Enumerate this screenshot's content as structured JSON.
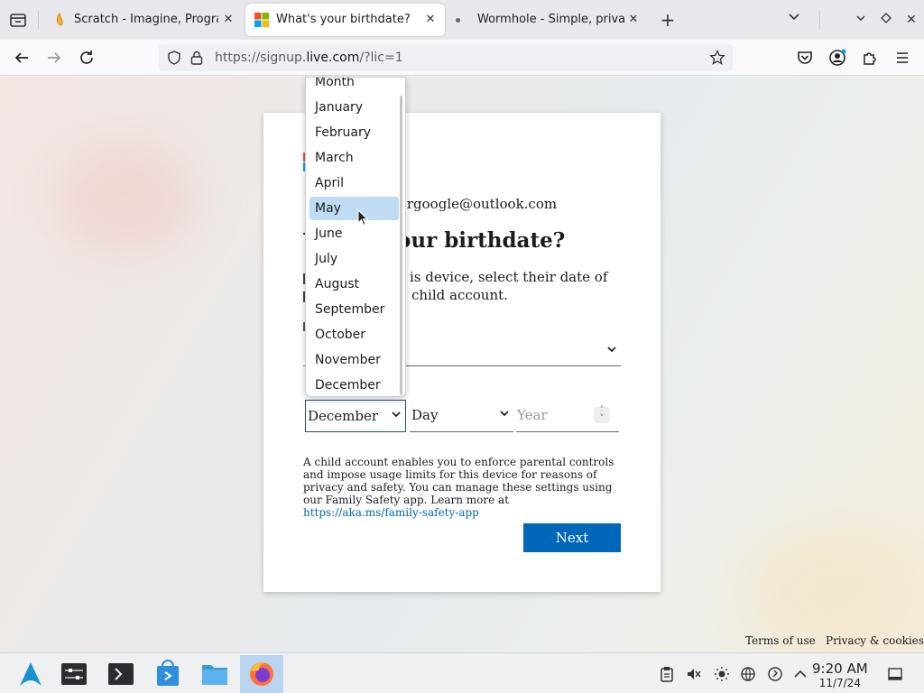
{
  "browser": {
    "tabs": [
      {
        "title": "Scratch - Imagine, Program"
      },
      {
        "title": "What's your birthdate?"
      },
      {
        "title": "Wormhole - Simple, private"
      }
    ],
    "url_prefix": "https://signup.",
    "url_domain": "live.com",
    "url_suffix": "/?lic=1"
  },
  "page": {
    "email": "ergoogle@outlook.com",
    "heading": "our birthdate?",
    "desc_line1": "is device, select their date of",
    "desc_line2": "child account.",
    "month_value": "December",
    "day_placeholder": "Day",
    "year_placeholder": "Year",
    "info_text": "A child account enables you to enforce parental controls and impose usage limits for this device for reasons of privacy and safety. You can manage these settings using our Family Safety app. Learn more at ",
    "info_link": "https://aka.ms/family-safety-app",
    "next_label": "Next",
    "footer_terms": "Terms of use",
    "footer_privacy": "Privacy & cookies"
  },
  "dropdown": {
    "items": [
      "Month",
      "January",
      "February",
      "March",
      "April",
      "May",
      "June",
      "July",
      "August",
      "September",
      "October",
      "November",
      "December"
    ],
    "highlighted": "May"
  },
  "taskbar": {
    "time": "9:20 AM",
    "date": "11/7/24"
  },
  "colors": {
    "accent": "#0067b8",
    "highlight": "#bfdcf2",
    "ms_red": "#f25022",
    "ms_green": "#7fba00",
    "ms_blue": "#00a4ef",
    "ms_yellow": "#ffb900"
  }
}
